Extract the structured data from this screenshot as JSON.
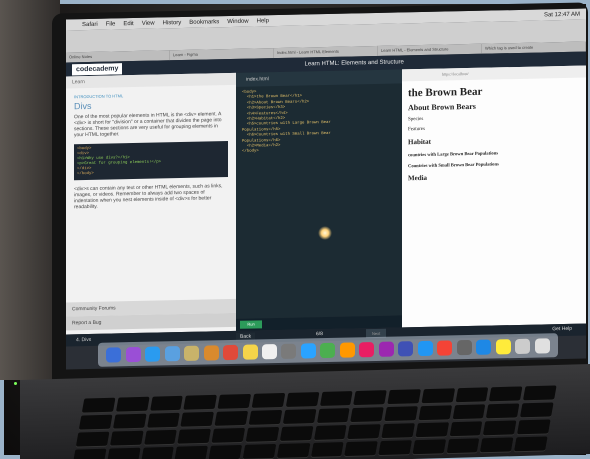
{
  "menubar": {
    "items": [
      "Safari",
      "File",
      "Edit",
      "View",
      "History",
      "Bookmarks",
      "Window",
      "Help"
    ],
    "clock": "Sat 12:47 AM"
  },
  "tabs": [
    "Online Notes",
    "Learn - Figma",
    "Index.html - Learn HTML Elements",
    "Learn HTML - Elements and Structure",
    "Which tag is used to create"
  ],
  "codecademy": {
    "logo": "codecademy",
    "title": "Learn HTML: Elements and Structure"
  },
  "lesson_panel": {
    "learn_tab": "Learn",
    "section_label": "INTRODUCTION TO HTML",
    "heading": "Divs",
    "paragraph1": "One of the most popular elements in HTML is the <div> element. A <div> is short for \"division\" or a container that divides the page into sections. These sections are very useful for grouping elements in your HTML together.",
    "code_lines": [
      "<body>",
      "  <div>",
      "    <h1>Why use divs?</h1>",
      "    <p>Great for grouping elements!</p>",
      "  </div>",
      "</body>"
    ],
    "paragraph2": "<div>s can contain any text or other HTML elements, such as links, images, or videos. Remember to always add two spaces of indentation when you nest elements inside of <div>s for better readability.",
    "community": "Community Forums",
    "report": "Report a Bug"
  },
  "editor": {
    "filename": "index.html",
    "lines": [
      "<body>",
      "  <h1>the Brown Bear</h1>",
      "  <h2>About Brown Bears</h2>",
      "  <h3>Species</h3>",
      "  <h4>Features</h4>",
      "  <h2>Habitat</h2>",
      "  <h5>countries with Large Brown Bear",
      "Populations</h5>",
      "  <h6>Countries with Small Brown Bear",
      "Populations</h6>",
      "  <h2>Media</h2>",
      "</body>"
    ],
    "run_label": "Run"
  },
  "preview": {
    "url": "https://localhost/",
    "h1": "the Brown Bear",
    "h2a": "About Brown Bears",
    "h3": "Species",
    "h4": "Features",
    "h2b": "Habitat",
    "h5": "countries with Large Brown Bear Populations",
    "h6": "Countries with Small Brown Bear Populations",
    "h2c": "Media"
  },
  "bottom": {
    "lesson": "4. Divs",
    "back": "Back",
    "progress": "6/8",
    "next": "Next",
    "help": "Get Help"
  },
  "dock_colors": [
    "#3b6fd8",
    "#9a4fd6",
    "#2a9bf0",
    "#5aa0e0",
    "#c9b36a",
    "#d98a2e",
    "#e04a3a",
    "#f5d44a",
    "#f0f0f0",
    "#7a7a7a",
    "#2aa3ff",
    "#4caf50",
    "#ff9800",
    "#e91e63",
    "#9c27b0",
    "#3f51b5",
    "#2196f3",
    "#f44336",
    "#666666",
    "#1e88e5",
    "#ffeb3b",
    "#cccccc",
    "#e0e0e0"
  ]
}
